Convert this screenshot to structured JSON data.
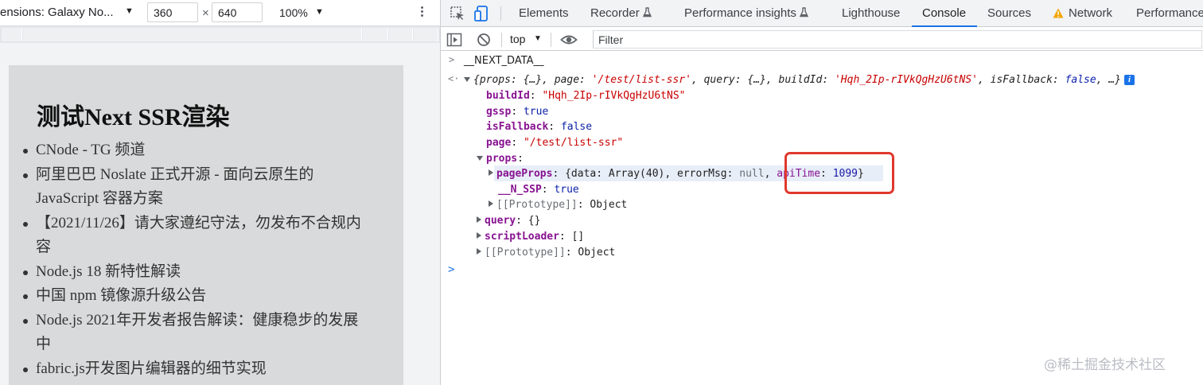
{
  "device_toolbar": {
    "dimensions_label": "ensions: Galaxy No...",
    "width": "360",
    "height": "640",
    "times": "×",
    "zoom": "100%"
  },
  "page": {
    "title": "测试Next SSR渲染",
    "news_items": [
      "CNode - TG 频道",
      "阿里巴巴 Noslate 正式开源 - 面向云原生的JavaScript 容器方案",
      "【2021/11/26】请大家遵纪守法，勿发布不合规内容",
      "Node.js 18 新特性解读",
      "中国 npm 镜像源升级公告",
      "Node.js 2021年开发者报告解读：健康稳步的发展中",
      "fabric.js开发图片编辑器的细节实现"
    ]
  },
  "devtools": {
    "tabs": {
      "elements": "Elements",
      "recorder": "Recorder",
      "performance_insights": "Performance insights",
      "lighthouse": "Lighthouse",
      "console": "Console",
      "sources": "Sources",
      "network": "Network",
      "performance": "Performance"
    },
    "active_tab": "Console",
    "console_toolbar": {
      "context": "top",
      "filter_placeholder": "Filter"
    },
    "console": {
      "command": "__NEXT_DATA__",
      "summary": {
        "p1": "{props: {…}, page: ",
        "page": "'/test/list-ssr'",
        "p2": ", query: {…}, buildId: ",
        "build": "'Hqh_2Ip-rIVkQgHzU6tNS'",
        "p3": ", isFallback: ",
        "fallback": "false",
        "p4": ", …}",
        "info": "i"
      },
      "props_lines": {
        "buildId_key": "buildId",
        "buildId_val": "\"Hqh_2Ip-rIVkQgHzU6tNS\"",
        "gssp_key": "gssp",
        "gssp_val": "true",
        "isFallback_key": "isFallback",
        "isFallback_val": "false",
        "page_key": "page",
        "page_val": "\"/test/list-ssr\"",
        "props_key": "props",
        "pageProps_key": "pageProps",
        "pageProps_p1": "{data: ",
        "pageProps_array": "Array(40)",
        "pageProps_p2": ", errorMsg: ",
        "pageProps_null": "null",
        "pageProps_p3": ", ",
        "apiTime_key": "apiTime",
        "apiTime_colon": ": ",
        "apiTime_val": "1099",
        "pageProps_close": "}",
        "nssp_key": "__N_SSP",
        "nssp_val": "true",
        "proto_inner": "[[Prototype]]",
        "proto_inner_val": "Object",
        "query_key": "query",
        "query_val": "{}",
        "scriptLoader_key": "scriptLoader",
        "scriptLoader_val": "[]",
        "proto_outer": "[[Prototype]]",
        "proto_outer_val": "Object"
      }
    }
  },
  "watermark": "@稀土掘金技术社区"
}
